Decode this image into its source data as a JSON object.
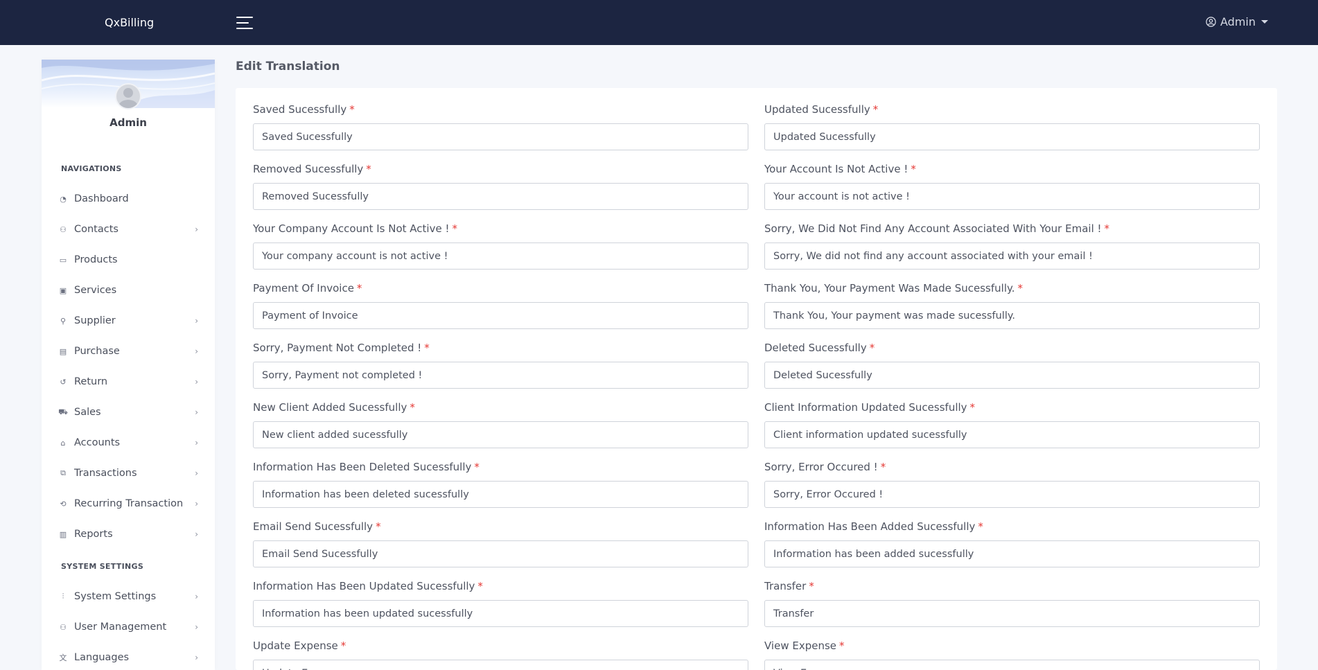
{
  "topbar": {
    "brand": "QxBilling",
    "user_label": "Admin"
  },
  "sidebar": {
    "profile_name": "Admin",
    "section_nav": "NAVIGATIONS",
    "items": [
      {
        "label": "Dashboard",
        "icon": "dashboard-icon"
      },
      {
        "label": "Contacts",
        "icon": "contacts-icon"
      },
      {
        "label": "Products",
        "icon": "products-icon"
      },
      {
        "label": "Services",
        "icon": "services-icon"
      },
      {
        "label": "Supplier",
        "icon": "supplier-icon"
      },
      {
        "label": "Purchase",
        "icon": "purchase-icon"
      },
      {
        "label": "Return",
        "icon": "return-icon"
      },
      {
        "label": "Sales",
        "icon": "cart-icon"
      },
      {
        "label": "Accounts",
        "icon": "bank-icon"
      },
      {
        "label": "Transactions",
        "icon": "transactions-icon"
      },
      {
        "label": "Recurring Transaction",
        "icon": "recurring-icon"
      },
      {
        "label": "Reports",
        "icon": "bar-chart-icon"
      }
    ],
    "section_system": "SYSTEM SETTINGS",
    "system_items": [
      {
        "label": "System Settings",
        "icon": "sliders-icon"
      },
      {
        "label": "User Management",
        "icon": "users-icon"
      },
      {
        "label": "Languages",
        "icon": "translate-icon"
      }
    ]
  },
  "page": {
    "title": "Edit Translation"
  },
  "form": {
    "required_mark": "*",
    "fields": [
      {
        "label": "Saved Sucessfully",
        "value": "Saved Sucessfully"
      },
      {
        "label": "Updated Sucessfully",
        "value": "Updated Sucessfully"
      },
      {
        "label": "Removed Sucessfully",
        "value": "Removed Sucessfully"
      },
      {
        "label": "Your Account Is Not Active !",
        "value": "Your account is not active !"
      },
      {
        "label": "Your Company Account Is Not Active !",
        "value": "Your company account is not active !"
      },
      {
        "label": "Sorry, We Did Not Find Any Account Associated With Your Email !",
        "value": "Sorry, We did not find any account associated with your email !"
      },
      {
        "label": "Payment Of Invoice",
        "value": "Payment of Invoice"
      },
      {
        "label": "Thank You, Your Payment Was Made Sucessfully.",
        "value": "Thank You, Your payment was made sucessfully."
      },
      {
        "label": "Sorry, Payment Not Completed !",
        "value": "Sorry, Payment not completed !"
      },
      {
        "label": "Deleted Sucessfully",
        "value": "Deleted Sucessfully"
      },
      {
        "label": "New Client Added Sucessfully",
        "value": "New client added sucessfully"
      },
      {
        "label": "Client Information Updated Sucessfully",
        "value": "Client information updated sucessfully"
      },
      {
        "label": "Information Has Been Deleted Sucessfully",
        "value": "Information has been deleted sucessfully"
      },
      {
        "label": "Sorry, Error Occured !",
        "value": "Sorry, Error Occured !"
      },
      {
        "label": "Email Send Sucessfully",
        "value": "Email Send Sucessfully"
      },
      {
        "label": "Information Has Been Added Sucessfully",
        "value": "Information has been added sucessfully"
      },
      {
        "label": "Information Has Been Updated Sucessfully",
        "value": "Information has been updated sucessfully"
      },
      {
        "label": "Transfer",
        "value": "Transfer"
      },
      {
        "label": "Update Expense",
        "value": "Update Expense"
      },
      {
        "label": "View Expense",
        "value": "View Expense"
      }
    ]
  }
}
